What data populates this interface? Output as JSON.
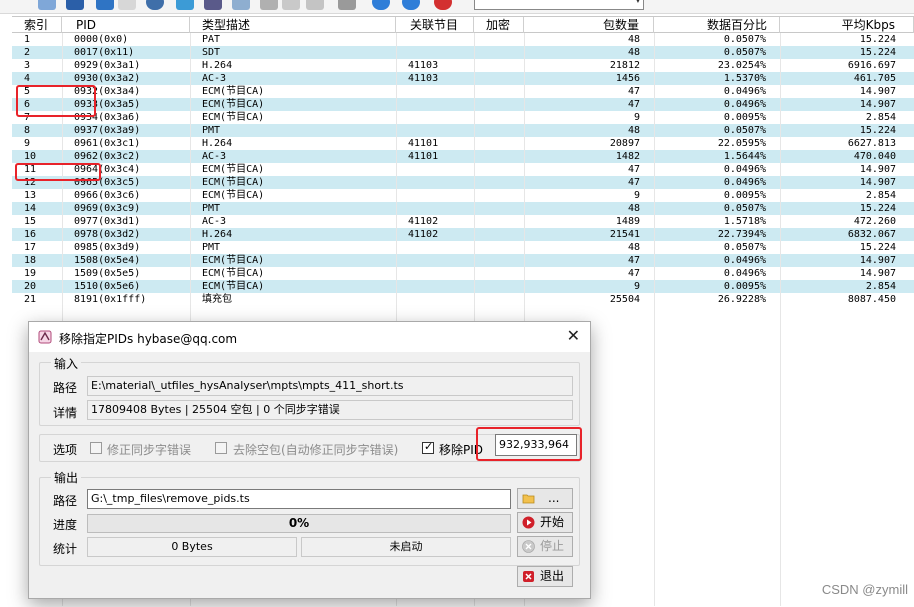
{
  "table": {
    "headers": [
      "索引",
      "PID",
      "类型描述",
      "关联节目",
      "加密",
      "包数量",
      "数据百分比",
      "平均Kbps"
    ],
    "rows": [
      [
        "1",
        "0000(0x0)",
        "PAT",
        "",
        "",
        "48",
        "0.0507%",
        "15.224"
      ],
      [
        "2",
        "0017(0x11)",
        "SDT",
        "",
        "",
        "48",
        "0.0507%",
        "15.224"
      ],
      [
        "3",
        "0929(0x3a1)",
        "H.264",
        "41103",
        "",
        "21812",
        "23.0254%",
        "6916.697"
      ],
      [
        "4",
        "0930(0x3a2)",
        "AC-3",
        "41103",
        "",
        "1456",
        "1.5370%",
        "461.705"
      ],
      [
        "5",
        "0932(0x3a4)",
        "ECM(节目CA)",
        "",
        "",
        "47",
        "0.0496%",
        "14.907"
      ],
      [
        "6",
        "0933(0x3a5)",
        "ECM(节目CA)",
        "",
        "",
        "47",
        "0.0496%",
        "14.907"
      ],
      [
        "7",
        "0934(0x3a6)",
        "ECM(节目CA)",
        "",
        "",
        "9",
        "0.0095%",
        "2.854"
      ],
      [
        "8",
        "0937(0x3a9)",
        "PMT",
        "",
        "",
        "48",
        "0.0507%",
        "15.224"
      ],
      [
        "9",
        "0961(0x3c1)",
        "H.264",
        "41101",
        "",
        "20897",
        "22.0595%",
        "6627.813"
      ],
      [
        "10",
        "0962(0x3c2)",
        "AC-3",
        "41101",
        "",
        "1482",
        "1.5644%",
        "470.040"
      ],
      [
        "11",
        "0964(0x3c4)",
        "ECM(节目CA)",
        "",
        "",
        "47",
        "0.0496%",
        "14.907"
      ],
      [
        "12",
        "0965(0x3c5)",
        "ECM(节目CA)",
        "",
        "",
        "47",
        "0.0496%",
        "14.907"
      ],
      [
        "13",
        "0966(0x3c6)",
        "ECM(节目CA)",
        "",
        "",
        "9",
        "0.0095%",
        "2.854"
      ],
      [
        "14",
        "0969(0x3c9)",
        "PMT",
        "",
        "",
        "48",
        "0.0507%",
        "15.224"
      ],
      [
        "15",
        "0977(0x3d1)",
        "AC-3",
        "41102",
        "",
        "1489",
        "1.5718%",
        "472.260"
      ],
      [
        "16",
        "0978(0x3d2)",
        "H.264",
        "41102",
        "",
        "21541",
        "22.7394%",
        "6832.067"
      ],
      [
        "17",
        "0985(0x3d9)",
        "PMT",
        "",
        "",
        "48",
        "0.0507%",
        "15.224"
      ],
      [
        "18",
        "1508(0x5e4)",
        "ECM(节目CA)",
        "",
        "",
        "47",
        "0.0496%",
        "14.907"
      ],
      [
        "19",
        "1509(0x5e5)",
        "ECM(节目CA)",
        "",
        "",
        "47",
        "0.0496%",
        "14.907"
      ],
      [
        "20",
        "1510(0x5e6)",
        "ECM(节目CA)",
        "",
        "",
        "9",
        "0.0095%",
        "2.854"
      ],
      [
        "21",
        "8191(0x1fff)",
        "填充包",
        "",
        "",
        "25504",
        "26.9228%",
        "8087.450"
      ]
    ]
  },
  "dialog": {
    "title": "移除指定PIDs   hybase@qq.com",
    "close_glyph": "✕",
    "input_group": "输入",
    "path_label": "路径",
    "input_path": "E:\\material\\_utfiles_hysAnalyser\\mpts\\mpts_411_short.ts",
    "detail_label": "详情",
    "detail_value": "17809408 Bytes   |   25504 空包   |   0 个同步字错误",
    "options_label": "选项",
    "opt_fix_sync": "修正同步字错误",
    "opt_remove_null": "去除空包(自动修正同步字错误)",
    "opt_remove_pid": "移除PID",
    "pid_value": "932,933,964",
    "output_group": "输出",
    "output_path_label": "路径",
    "output_path": "G:\\_tmp_files\\remove_pids.ts",
    "browse_label": "...",
    "progress_label": "进度",
    "progress_text": "0%",
    "progress_value": 0,
    "start_label": "开始",
    "stats_label": "统计",
    "stats_bytes": "0 Bytes",
    "stats_status": "未启动",
    "stop_label": "停止",
    "exit_label": "退出"
  },
  "watermark": "CSDN @zymill",
  "colors": {
    "row_alt": "#cdeaf2",
    "highlight": "#e8232a",
    "start_icon": "#d0202a",
    "exit_icon": "#d0202a"
  }
}
